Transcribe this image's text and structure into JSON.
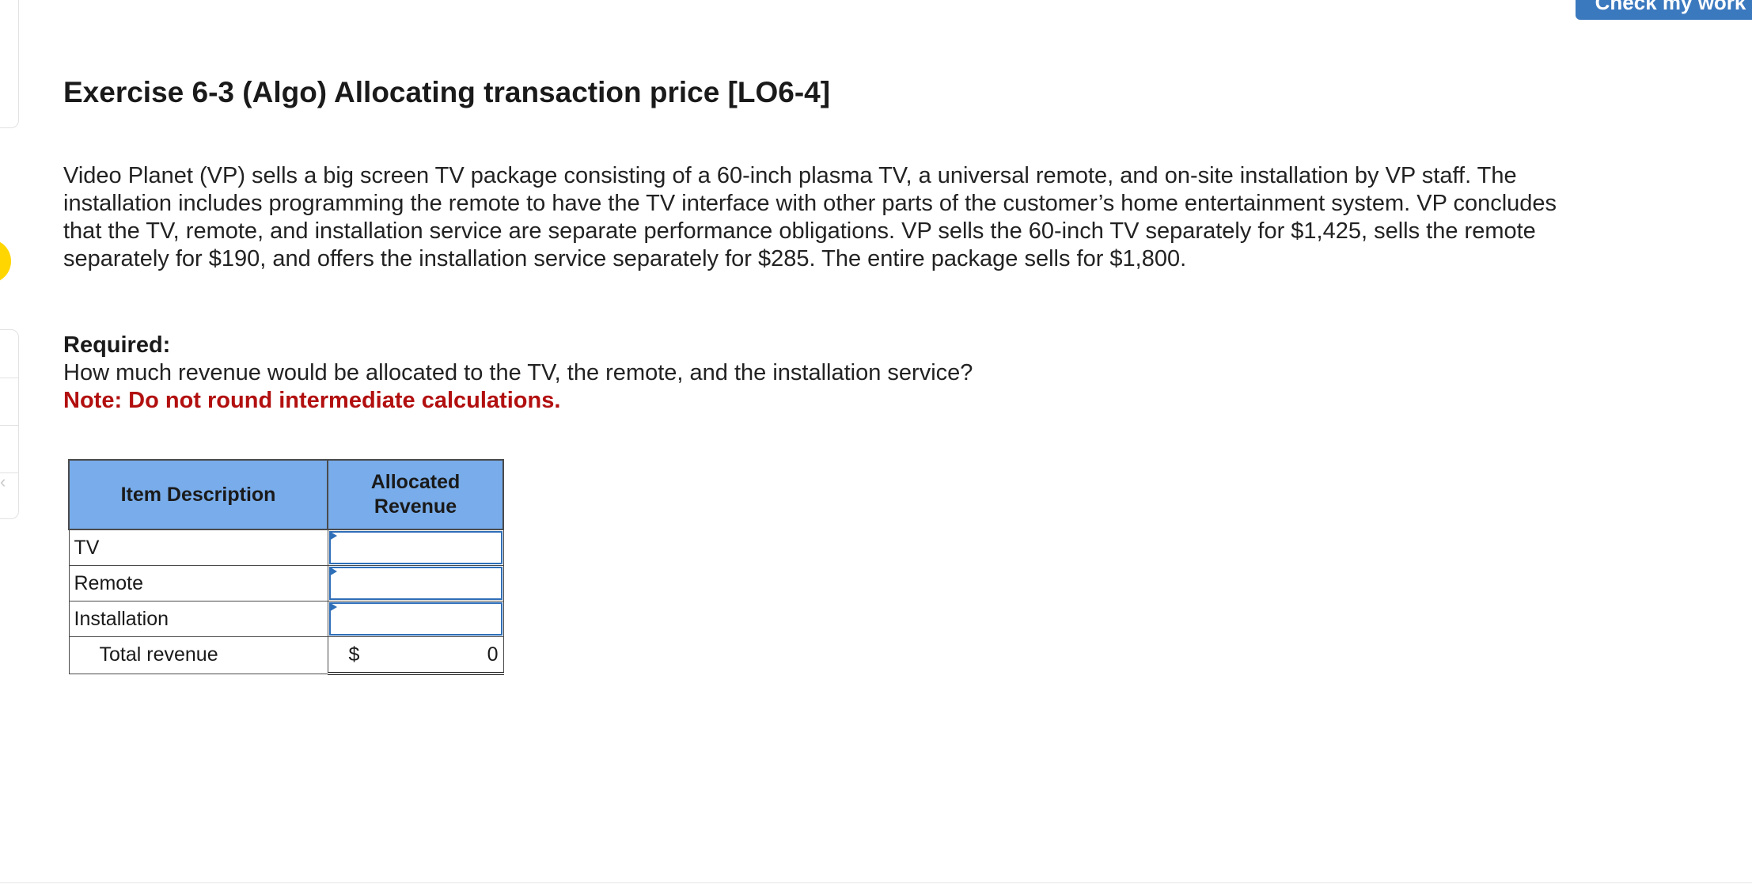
{
  "header": {
    "check_work_label": "Check my work"
  },
  "exercise": {
    "title": "Exercise 6-3 (Algo) Allocating transaction price [LO6-4]",
    "description": "Video Planet (VP) sells a big screen TV package consisting of a 60-inch plasma TV, a universal remote, and on-site installation by VP staff. The installation includes programming the remote to have the TV interface with other parts of the customer’s home entertainment system. VP concludes that the TV, remote, and installation service are separate performance obligations. VP sells the 60-inch TV separately for $1,425, sells the remote separately for $190, and offers the installation service separately for $285. The entire package sells for $1,800.",
    "required_label": "Required:",
    "question": "How much revenue would be allocated to the TV, the remote, and the installation service?",
    "note": "Note: Do not round intermediate calculations."
  },
  "table": {
    "headers": {
      "item": "Item Description",
      "revenue": "Allocated Revenue"
    },
    "rows": [
      {
        "label": "TV",
        "value": ""
      },
      {
        "label": "Remote",
        "value": ""
      },
      {
        "label": "Installation",
        "value": ""
      }
    ],
    "total": {
      "label": "Total revenue",
      "currency": "$",
      "value": "0"
    }
  },
  "colors": {
    "header_fill": "#78acea",
    "button_fill": "#3b79bf",
    "note_red": "#b20f0f",
    "input_border": "#2f6fb8"
  }
}
